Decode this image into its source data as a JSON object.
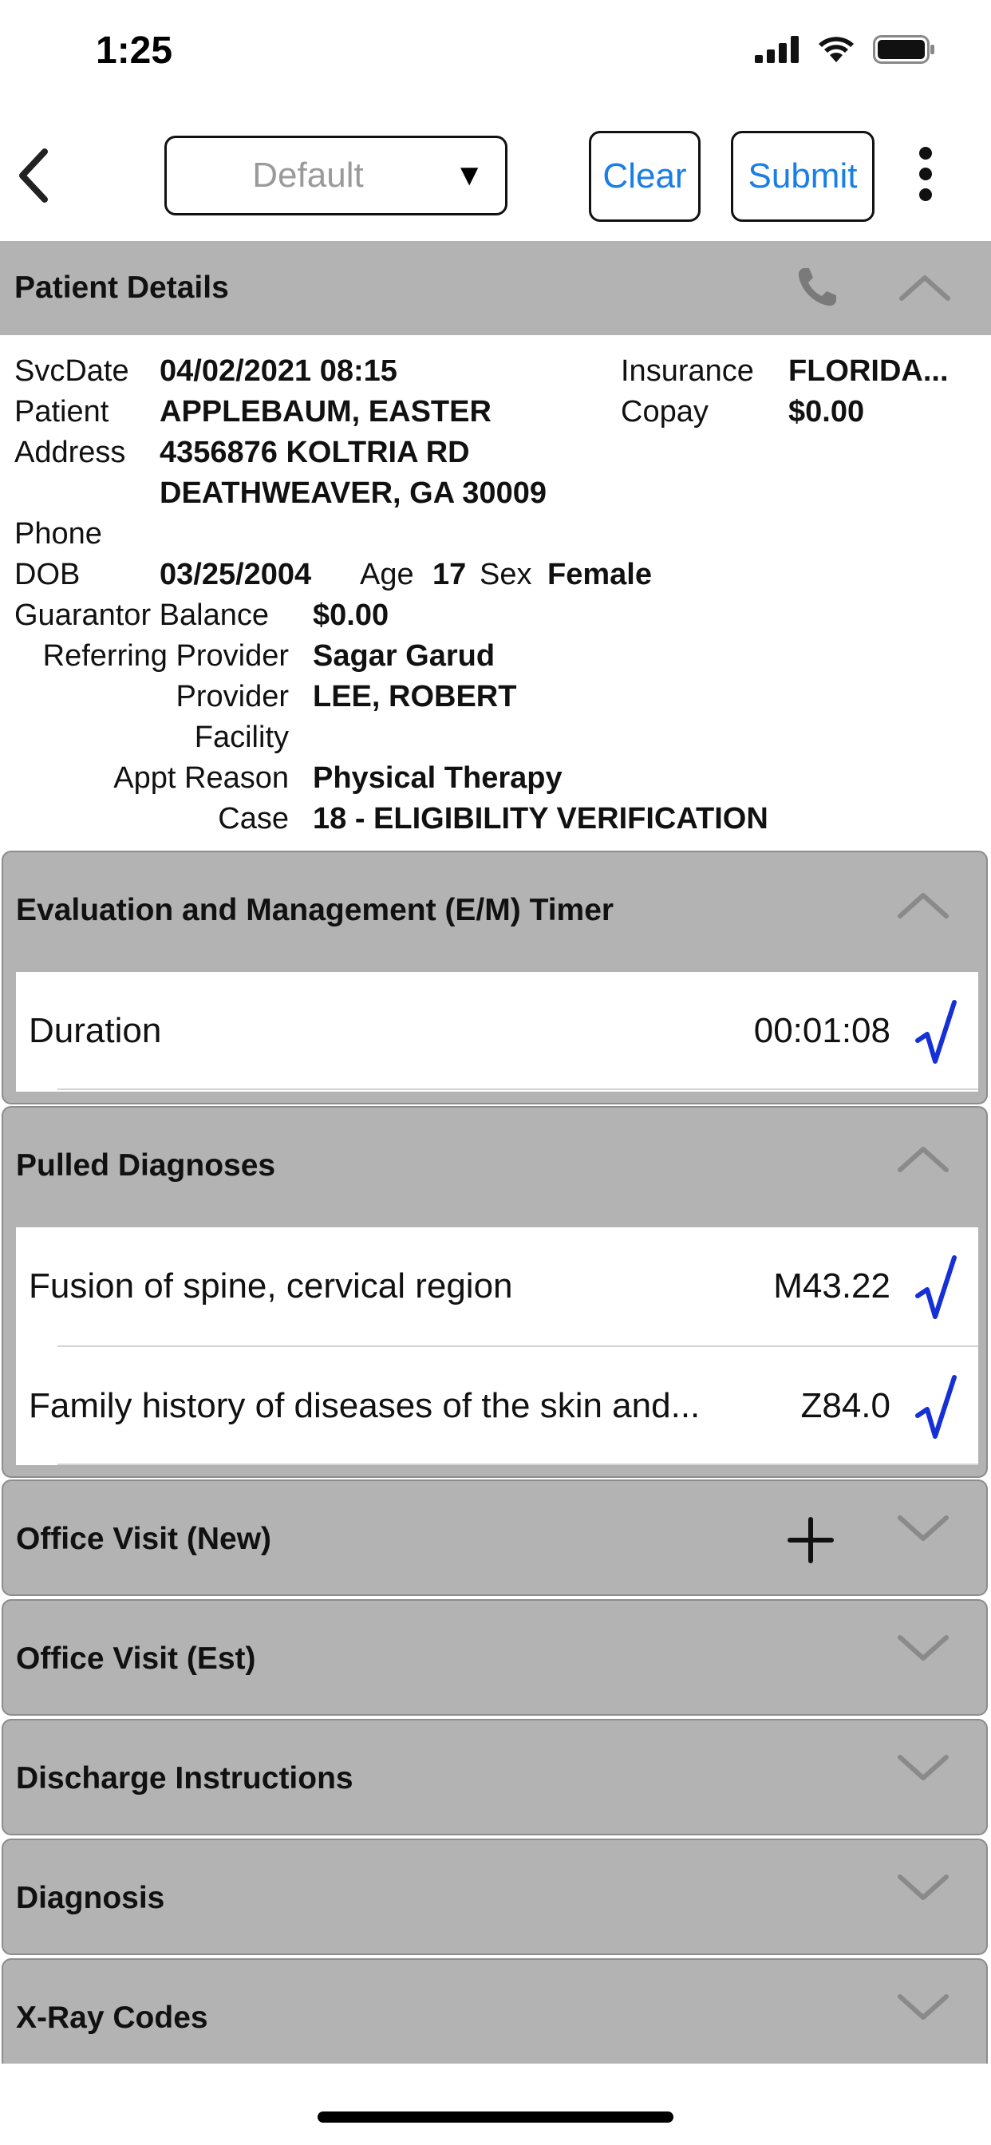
{
  "status_bar": {
    "time": "1:25"
  },
  "nav": {
    "back_icon": "chevron-left-icon",
    "template_select": {
      "value": "Default"
    },
    "clear_label": "Clear",
    "submit_label": "Submit",
    "more_icon": "vertical-ellipsis-icon"
  },
  "patient_details": {
    "title": "Patient Details",
    "svc_date_label": "SvcDate",
    "svc_date": "04/02/2021 08:15",
    "patient_label": "Patient",
    "patient": "APPLEBAUM, EASTER",
    "address_label": "Address",
    "address_line1": "4356876 KOLTRIA RD",
    "address_line2": "DEATHWEAVER, GA 30009",
    "phone_label": "Phone",
    "dob_label": "DOB",
    "dob": "03/25/2004",
    "age_label": "Age",
    "age": "17",
    "sex_label": "Sex",
    "sex": "Female",
    "insurance_label": "Insurance",
    "insurance": "FLORIDA...",
    "copay_label": "Copay",
    "copay": "$0.00",
    "guarantor_balance_label": "Guarantor Balance",
    "guarantor_balance": "$0.00",
    "referring_provider_label": "Referring Provider",
    "referring_provider": "Sagar Garud",
    "provider_label": "Provider",
    "provider": "LEE, ROBERT",
    "facility_label": "Facility",
    "appt_reason_label": "Appt Reason",
    "appt_reason": "Physical Therapy",
    "case_label": "Case",
    "case": "18 - ELIGIBILITY VERIFICATION"
  },
  "em_timer": {
    "title": "Evaluation and Management (E/M) Timer",
    "duration_label": "Duration",
    "duration_value": "00:01:08"
  },
  "pulled_diagnoses": {
    "title": "Pulled Diagnoses",
    "items": [
      {
        "label": "Fusion of spine, cervical region",
        "code": "M43.22"
      },
      {
        "label": "Family history of diseases of the skin and...",
        "code": "Z84.0"
      }
    ]
  },
  "collapsed_sections": [
    {
      "title": "Office Visit (New)"
    },
    {
      "title": "Office Visit (Est)"
    },
    {
      "title": "Discharge Instructions"
    },
    {
      "title": "Diagnosis"
    },
    {
      "title": "X-Ray Codes"
    }
  ],
  "colors": {
    "accent": "#1a7ee6",
    "check": "#1530d6",
    "section_bg": "#b3b3b3"
  }
}
